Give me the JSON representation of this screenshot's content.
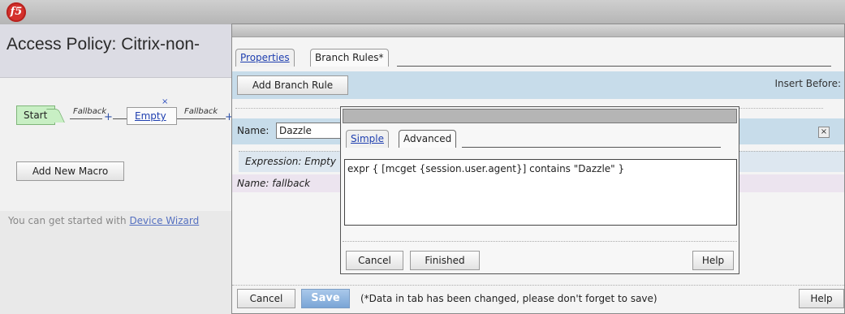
{
  "app": {
    "logo_text": "f5",
    "page_title": "Access Policy: Citrix-non-"
  },
  "flow": {
    "start_label": "Start",
    "fallback_label_1": "Fallback",
    "fallback_label_2": "Fallback",
    "empty_label": "Empty",
    "plus": "+",
    "remove": "×"
  },
  "left": {
    "add_macro_label": "Add New Macro",
    "hint_text": "You can get started with ",
    "hint_link": "Device Wizard"
  },
  "dialog": {
    "tabs": [
      {
        "label": "Properties",
        "active": false
      },
      {
        "label": "Branch Rules*",
        "active": true
      }
    ],
    "add_branch_label": "Add Branch Rule",
    "insert_before_label": "Insert Before:",
    "name_label": "Name:",
    "name_value": "Dazzle",
    "expression_label": "Expression: Empty",
    "fallback_name": "Name: fallback",
    "close_glyph": "×",
    "cancel_label": "Cancel",
    "save_label": "Save",
    "note": "(*Data in tab has been changed, please don't forget to save)",
    "help_label": "Help"
  },
  "popup": {
    "tabs": [
      {
        "label": "Simple",
        "active": false
      },
      {
        "label": "Advanced",
        "active": true
      }
    ],
    "expression_text": "expr { [mcget {session.user.agent}] contains \"Dazzle\" }",
    "cancel_label": "Cancel",
    "finished_label": "Finished",
    "help_label": "Help"
  },
  "colors": {
    "accent_blue": "#c7dcea",
    "save_blue": "#7aa5d6",
    "start_green": "#c8efc4",
    "logo_red": "#d4312c"
  }
}
